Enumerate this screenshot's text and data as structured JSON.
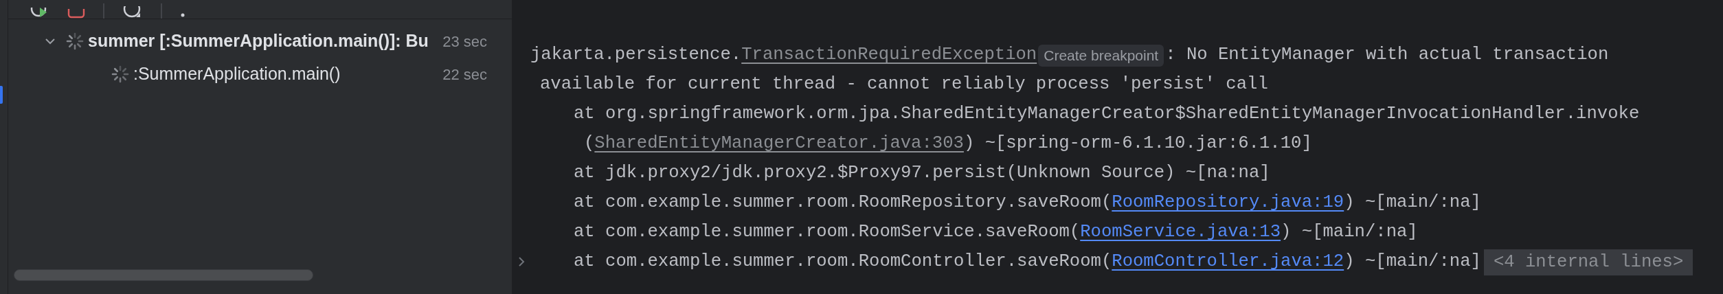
{
  "tree": [
    {
      "label": "summer [:SummerApplication.main()]: Bu",
      "time": "23 sec",
      "expanded": true,
      "running": true,
      "children": [
        {
          "label": ":SummerApplication.main()",
          "time": "22 sec",
          "running": true
        }
      ]
    }
  ],
  "console": [
    {
      "kind": "exception",
      "fold_marker": false,
      "segments": [
        {
          "kind": "text",
          "text": "jakarta.persistence."
        },
        {
          "kind": "muted-link",
          "text": "TransactionRequiredException"
        },
        {
          "kind": "hint",
          "text": "Create breakpoint"
        },
        {
          "kind": "text",
          "text": ": No EntityManager with actual transaction"
        }
      ]
    },
    {
      "kind": "exception-wrap",
      "fold_marker": false,
      "segments": [
        {
          "kind": "text",
          "text": "available for current thread - cannot reliably process 'persist' call"
        }
      ]
    },
    {
      "kind": "frame",
      "fold_marker": false,
      "segments": [
        {
          "kind": "text",
          "text": "at org.springframework.orm.jpa.SharedEntityManagerCreator$SharedEntityManagerInvocationHandler.invoke"
        }
      ]
    },
    {
      "kind": "frame-wrap",
      "fold_marker": false,
      "segments": [
        {
          "kind": "text",
          "text": "("
        },
        {
          "kind": "muted-link",
          "text": "SharedEntityManagerCreator.java:303"
        },
        {
          "kind": "text",
          "text": ") ~[spring-orm-6.1.10.jar:6.1.10]"
        }
      ]
    },
    {
      "kind": "frame",
      "fold_marker": false,
      "segments": [
        {
          "kind": "text",
          "text": "at jdk.proxy2/jdk.proxy2.$Proxy97.persist(Unknown Source) ~[na:na]"
        }
      ]
    },
    {
      "kind": "frame",
      "fold_marker": false,
      "segments": [
        {
          "kind": "text",
          "text": "at com.example.summer.room.RoomRepository.saveRoom("
        },
        {
          "kind": "link",
          "text": "RoomRepository.java:19"
        },
        {
          "kind": "text",
          "text": ") ~[main/:na]"
        }
      ]
    },
    {
      "kind": "frame",
      "fold_marker": false,
      "segments": [
        {
          "kind": "text",
          "text": "at com.example.summer.room.RoomService.saveRoom("
        },
        {
          "kind": "link",
          "text": "RoomService.java:13"
        },
        {
          "kind": "text",
          "text": ") ~[main/:na]"
        }
      ]
    },
    {
      "kind": "frame",
      "fold_marker": true,
      "segments": [
        {
          "kind": "text",
          "text": "at com.example.summer.room.RoomController.saveRoom("
        },
        {
          "kind": "link",
          "text": "RoomController.java:12"
        },
        {
          "kind": "text",
          "text": ") ~[main/:na]"
        },
        {
          "kind": "folded",
          "text": "<4 internal lines>"
        }
      ]
    }
  ]
}
